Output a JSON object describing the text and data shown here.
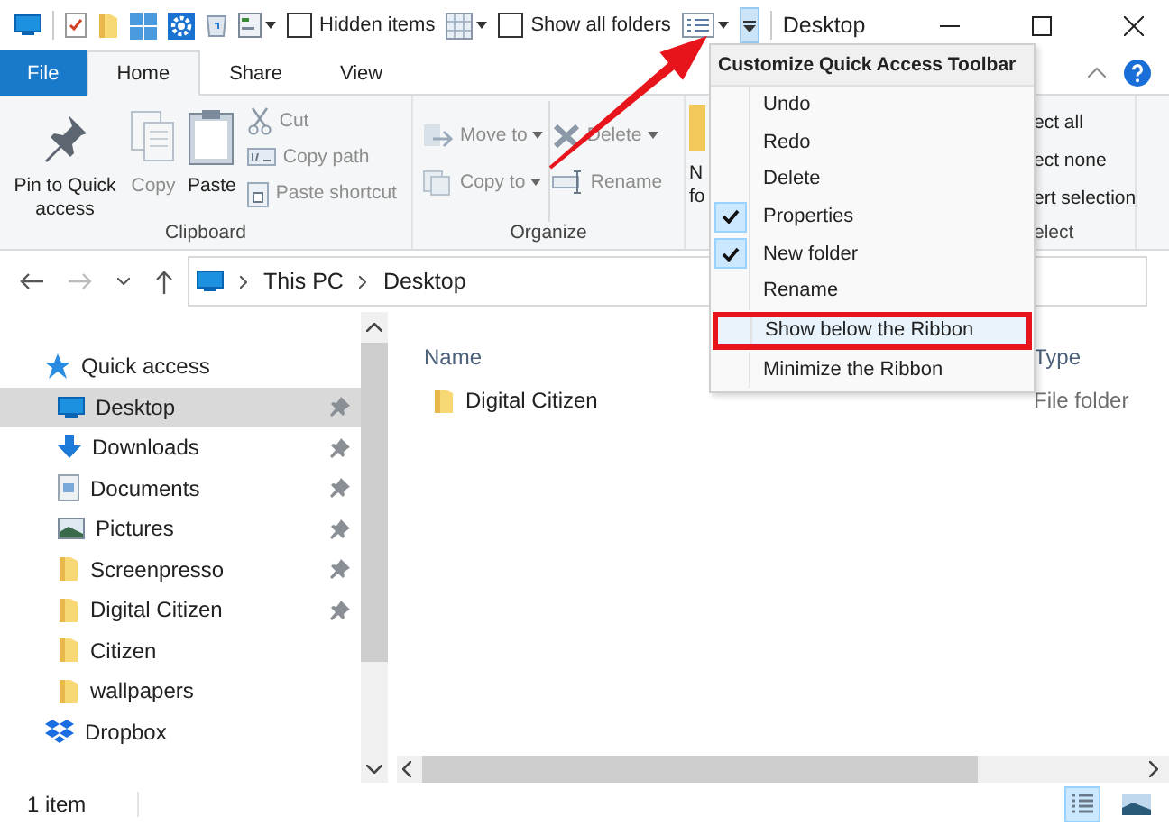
{
  "window": {
    "title": "Desktop"
  },
  "quick_access_toolbar": {
    "checkboxes": [
      {
        "label": "Hidden items",
        "checked": false
      },
      {
        "label": "Show all folders",
        "checked": false
      }
    ],
    "dropdown_open": true
  },
  "tabs": [
    {
      "label": "File",
      "kind": "file",
      "selected": false
    },
    {
      "label": "Home",
      "kind": "tab",
      "selected": true
    },
    {
      "label": "Share",
      "kind": "tab",
      "selected": false
    },
    {
      "label": "View",
      "kind": "tab",
      "selected": false
    }
  ],
  "ribbon": {
    "groups": [
      {
        "label": "Clipboard",
        "columns": [
          {
            "kind": "large",
            "items": [
              {
                "label": "Pin to Quick access",
                "disabled": false
              }
            ]
          },
          {
            "kind": "large",
            "items": [
              {
                "label": "Copy",
                "disabled": true
              }
            ]
          },
          {
            "kind": "large",
            "items": [
              {
                "label": "Paste",
                "disabled": false
              }
            ]
          },
          {
            "kind": "small",
            "items": [
              {
                "label": "Cut",
                "disabled": true
              },
              {
                "label": "Copy path",
                "disabled": true
              },
              {
                "label": "Paste shortcut",
                "disabled": true
              }
            ]
          }
        ]
      },
      {
        "label": "Organize",
        "columns": [
          {
            "kind": "small",
            "items": [
              {
                "label": "Move to",
                "disabled": true,
                "dropdown": true
              },
              {
                "label": "Copy to",
                "disabled": true,
                "dropdown": true
              }
            ]
          },
          {
            "kind": "small",
            "items": [
              {
                "label": "Delete",
                "disabled": true,
                "dropdown": true
              },
              {
                "label": "Rename",
                "disabled": true,
                "dropdown": false
              }
            ]
          }
        ]
      },
      {
        "columns": [
          {
            "kind": "fragment",
            "items": [
              {
                "label": "N"
              },
              {
                "label": "fo"
              }
            ]
          }
        ]
      },
      {
        "label": "elect",
        "columns": [
          {
            "kind": "small",
            "items": [
              {
                "label": "ect all"
              },
              {
                "label": "ect none"
              },
              {
                "label": "ert selection"
              }
            ]
          }
        ]
      }
    ]
  },
  "address_bar": {
    "crumbs": [
      "This PC",
      "Desktop"
    ]
  },
  "sidebar": {
    "items": [
      {
        "label": "Quick access",
        "selected": false,
        "children": [
          {
            "label": "Desktop",
            "selected": true,
            "pinned": true
          },
          {
            "label": "Downloads",
            "selected": false,
            "pinned": true
          },
          {
            "label": "Documents",
            "selected": false,
            "pinned": true
          },
          {
            "label": "Pictures",
            "selected": false,
            "pinned": true
          },
          {
            "label": "Screenpresso",
            "selected": false,
            "pinned": true
          },
          {
            "label": "Digital Citizen",
            "selected": false,
            "pinned": true
          },
          {
            "label": "Citizen",
            "selected": false,
            "pinned": false
          },
          {
            "label": "wallpapers",
            "selected": false,
            "pinned": false
          }
        ]
      },
      {
        "label": "Dropbox",
        "selected": false
      }
    ]
  },
  "file_list": {
    "columns": [
      "Name",
      "Type"
    ],
    "rows": [
      {
        "name": "Digital Citizen",
        "type": "File folder"
      }
    ]
  },
  "status_bar": {
    "text": "1 item",
    "views": [
      {
        "selected": true
      },
      {
        "selected": false
      }
    ]
  },
  "menu": {
    "title": "Customize Quick Access Toolbar",
    "items": [
      {
        "label": "Undo",
        "checked": false,
        "selected": false
      },
      {
        "label": "Redo",
        "checked": false,
        "selected": false
      },
      {
        "label": "Delete",
        "checked": false,
        "selected": false
      },
      {
        "label": "Properties",
        "checked": true,
        "selected": false
      },
      {
        "label": "New folder",
        "checked": true,
        "selected": false
      },
      {
        "label": "Rename",
        "checked": false,
        "selected": false
      },
      {
        "label": "Show below the Ribbon",
        "checked": false,
        "selected": true
      },
      {
        "label": "Minimize the Ribbon",
        "checked": false,
        "selected": false
      }
    ]
  }
}
